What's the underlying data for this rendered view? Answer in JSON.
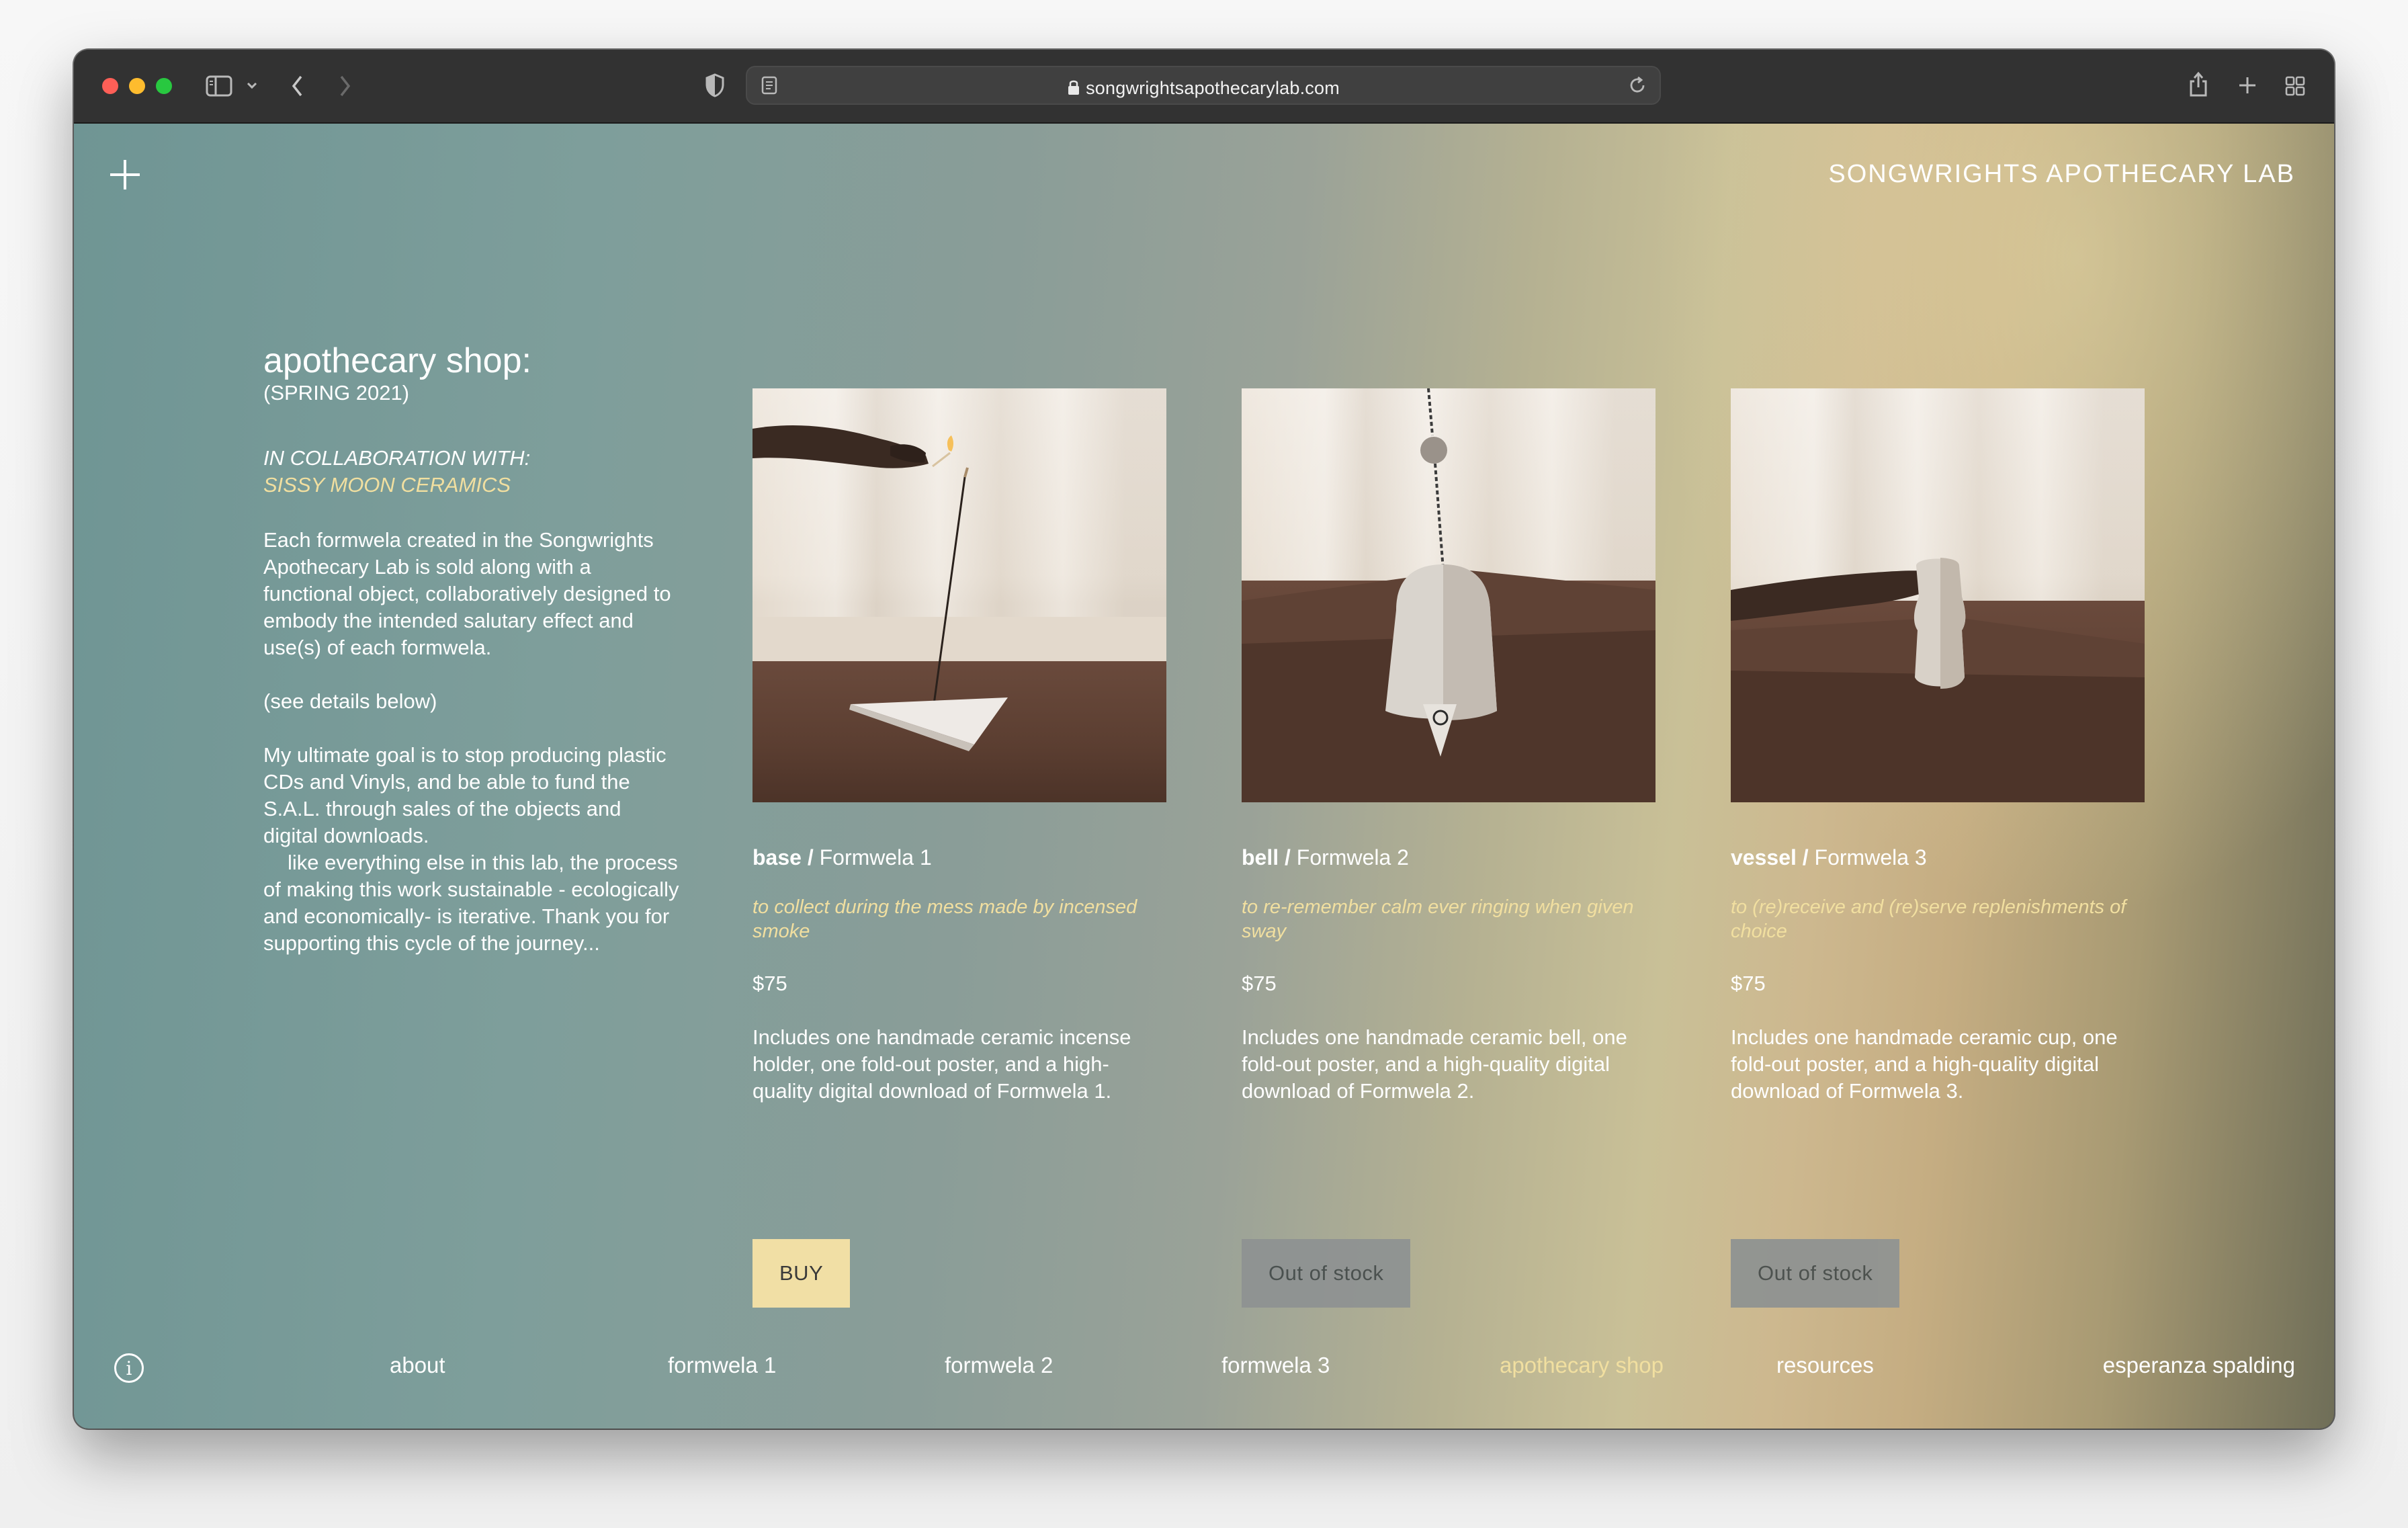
{
  "browser": {
    "url": "songwrightsapothecarylab.com",
    "icons": {
      "sidebar": "sidebar-icon",
      "back": "chevron-left-icon",
      "forward": "chevron-right-icon",
      "shield": "shield-icon",
      "reader": "reader-icon",
      "lock": "lock-icon",
      "reload": "reload-icon",
      "share": "share-icon",
      "new_tab": "plus-icon",
      "tabs": "tab-overview-icon"
    }
  },
  "site": {
    "title": "SONGWRIGHTS APOTHECARY LAB"
  },
  "intro": {
    "heading": "apothecary shop:",
    "season": "(SPRING 2021)",
    "collab_label": "IN COLLABORATION WITH:",
    "collab_partner": "SISSY MOON CERAMICS",
    "paragraph1": "Each formwela created in the Songwrights Apothecary Lab is sold along with a functional object, collaboratively designed to embody the intended salutary effect and use(s) of each formwela.",
    "paragraph2": "(see details below)",
    "paragraph3a": "My ultimate goal is to stop producing plastic CDs and Vinyls, and be able to fund the S.A.L. through sales of the objects and digital downloads.",
    "paragraph3b": "like everything else in this lab, the process of making this work sustainable - ecologically and economically- is iterative. Thank you for supporting this cycle of the journey..."
  },
  "products": [
    {
      "name": "base",
      "separator": " / ",
      "formwela": "Formwela 1",
      "tagline": "to collect during the mess made by incensed smoke",
      "price": "$75",
      "description": "Includes one handmade ceramic incense holder, one fold-out poster, and a high-quality digital download of Formwela 1.",
      "button": "BUY"
    },
    {
      "name": "bell",
      "separator": " / ",
      "formwela": "Formwela 2",
      "tagline": "to re-remember calm ever ringing when given sway",
      "price": "$75",
      "description": "Includes one handmade ceramic bell, one fold-out poster, and a high-quality digital download of Formwela 2.",
      "button": "Out of stock"
    },
    {
      "name": "vessel",
      "separator": " / ",
      "formwela": "Formwela 3",
      "tagline": "to (re)receive and (re)serve replenishments of choice",
      "price": "$75",
      "description": "Includes one handmade ceramic cup, one fold-out poster, and a high-quality digital download of Formwela 3.",
      "button": "Out of stock"
    }
  ],
  "footer": {
    "info_icon": "info-icon",
    "nav": [
      "about",
      "formwela 1",
      "formwela 2",
      "formwela 3",
      "apothecary shop",
      "resources",
      "esperanza spalding"
    ],
    "active": "apothecary shop"
  },
  "colors": {
    "accent_yellow": "#f1dfa0",
    "buy_button": "#f1dfa5",
    "out_of_stock_button": "#8e9292"
  }
}
